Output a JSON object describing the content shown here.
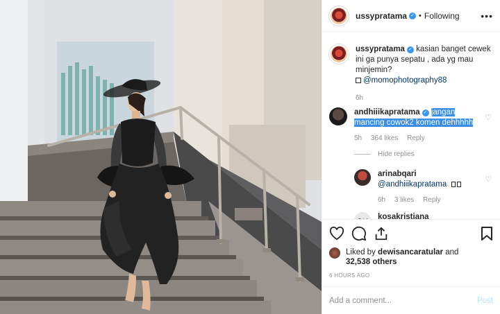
{
  "header": {
    "username": "ussypratama",
    "separator": "•",
    "follow_status": "Following",
    "more": "•••"
  },
  "caption": {
    "username": "ussypratama",
    "text": "kasian banget cewek ini ga punya sepatu , ada yg mau minjemin?",
    "mention": "@momophotography88",
    "age": "6h"
  },
  "comments": [
    {
      "username": "andhiiikapratama",
      "text": "jangan mancing cowok2 komen dehhhhh",
      "age": "5h",
      "likes": "364 likes",
      "reply_label": "Reply",
      "hide_replies": "Hide replies",
      "replies": [
        {
          "username": "arinabqari",
          "mention": "@andhiiikapratama",
          "age": "6h",
          "likes": "3 likes",
          "reply_label": "Reply"
        },
        {
          "username": "kosakristiana"
        }
      ]
    }
  ],
  "likes": {
    "prefix": "Liked by",
    "user": "dewisancaratular",
    "and": "and",
    "count": "32,538 others"
  },
  "timestamp": "6 HOURS AGO",
  "add_comment": {
    "placeholder": "Add a comment...",
    "post_label": "Post"
  },
  "icons": {
    "like": "heart-icon",
    "comment": "comment-icon",
    "share": "share-icon",
    "save": "bookmark-icon",
    "verified": "verified-badge-icon"
  },
  "colors": {
    "accent": "#3897f0",
    "selection": "#3a8ee8",
    "muted": "#8e8e8e",
    "post_disabled": "#b2dffc"
  }
}
